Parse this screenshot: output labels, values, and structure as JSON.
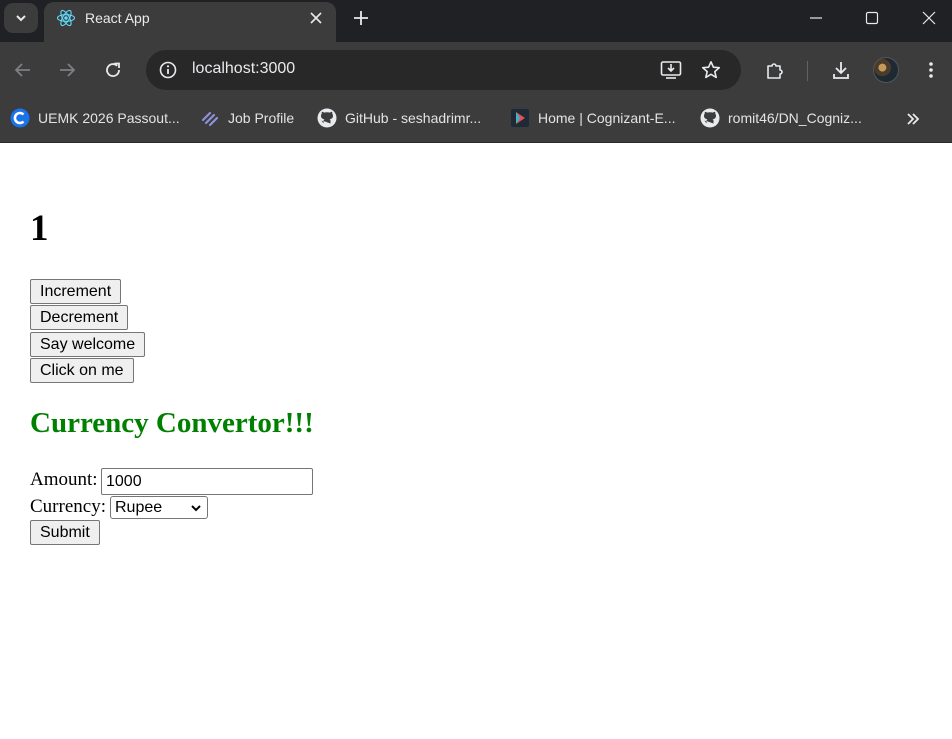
{
  "browser": {
    "tab_title": "React App",
    "url": "localhost:3000",
    "bookmarks": [
      {
        "label": "UEMK 2026 Passout...",
        "icon": "c-logo-icon"
      },
      {
        "label": "Job Profile",
        "icon": "link-logo-icon"
      },
      {
        "label": "GitHub - seshadrimr...",
        "icon": "github-icon"
      },
      {
        "label": "Home | Cognizant-E...",
        "icon": "play-logo-icon"
      },
      {
        "label": "romit46/DN_Cogniz...",
        "icon": "github-icon"
      }
    ]
  },
  "app": {
    "count": "1",
    "buttons": {
      "increment": "Increment",
      "decrement": "Decrement",
      "say_welcome": "Say welcome",
      "click_on_me": "Click on me"
    },
    "converter": {
      "title": "Currency Convertor!!!",
      "amount_label": "Amount:",
      "amount_value": "1000",
      "currency_label": "Currency:",
      "currency_selected": "Rupee",
      "submit_label": "Submit"
    }
  },
  "colors": {
    "title_green": "#008000",
    "chrome_dark": "#202124",
    "chrome_toolbar": "#3c3c3c"
  }
}
